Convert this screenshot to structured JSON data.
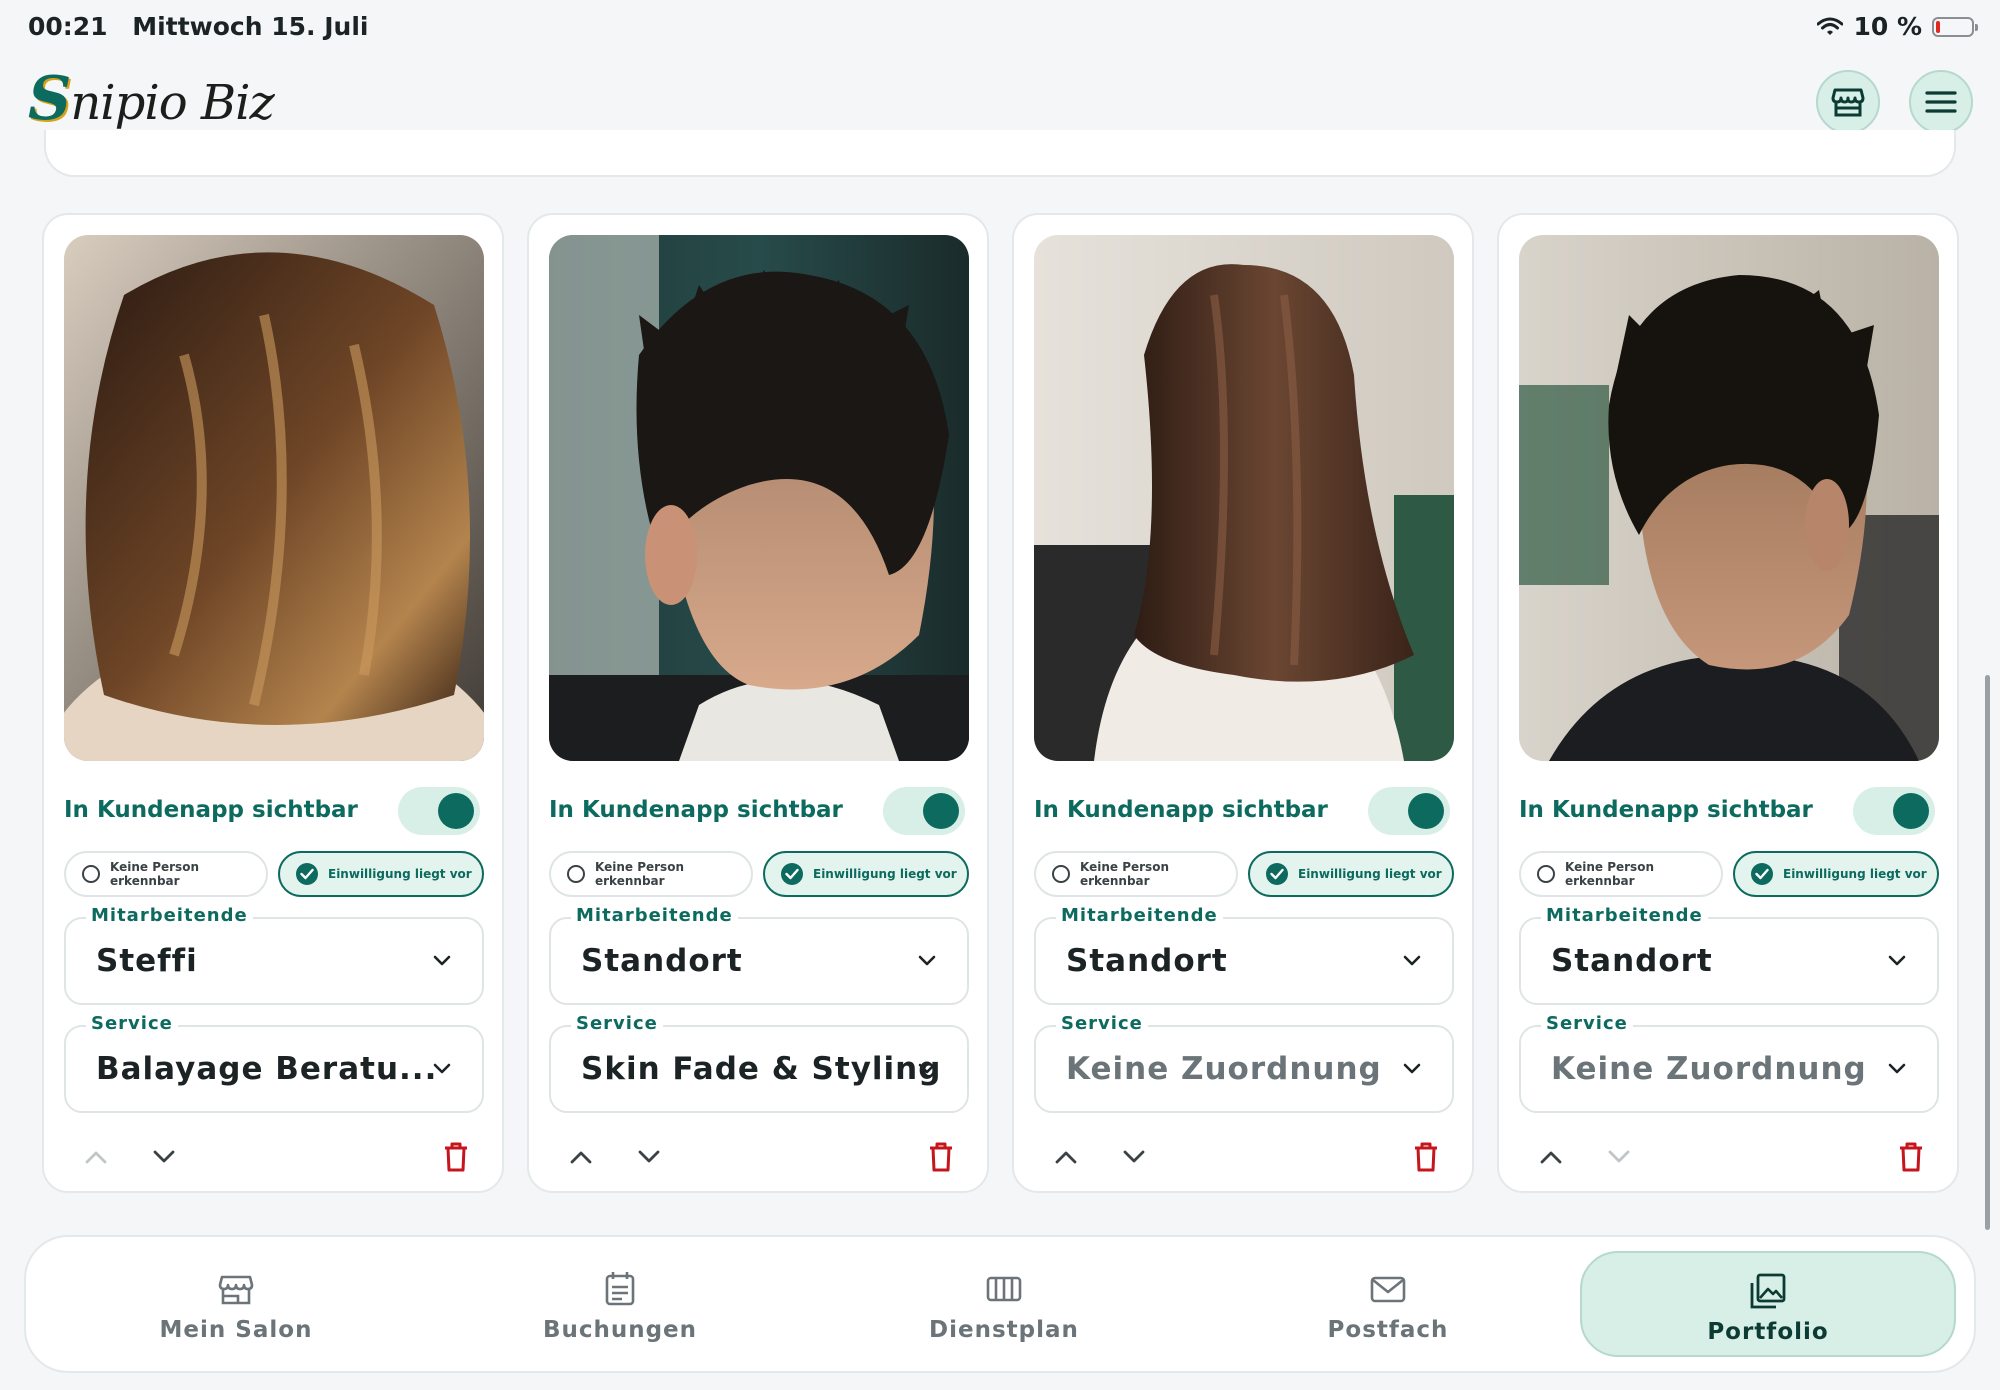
{
  "statusbar": {
    "time": "00:21",
    "date": "Mittwoch 15. Juli",
    "battery": "10 %"
  },
  "header": {
    "logo_initial": "S",
    "logo_rest": "nipio Biz"
  },
  "cards": [
    {
      "visible_label": "In Kundenapp sichtbar",
      "chip_off": "Keine Person erkennbar",
      "chip_on": "Einwilligung liegt vor",
      "staff_label": "Mitarbeitende",
      "staff_value": "Steffi",
      "service_label": "Service",
      "service_value": "Balayage Beratu..."
    },
    {
      "visible_label": "In Kundenapp sichtbar",
      "chip_off": "Keine Person erkennbar",
      "chip_on": "Einwilligung liegt vor",
      "staff_label": "Mitarbeitende",
      "staff_value": "Standort",
      "service_label": "Service",
      "service_value": "Skin Fade & Styling"
    },
    {
      "visible_label": "In Kundenapp sichtbar",
      "chip_off": "Keine Person erkennbar",
      "chip_on": "Einwilligung liegt vor",
      "staff_label": "Mitarbeitende",
      "staff_value": "Standort",
      "service_label": "Service",
      "service_value": "Keine Zuordnung"
    },
    {
      "visible_label": "In Kundenapp sichtbar",
      "chip_off": "Keine Person erkennbar",
      "chip_on": "Einwilligung liegt vor",
      "staff_label": "Mitarbeitende",
      "staff_value": "Standort",
      "service_label": "Service",
      "service_value": "Keine Zuordnung"
    }
  ],
  "nav": [
    {
      "label": "Mein Salon",
      "icon": "store-icon"
    },
    {
      "label": "Buchungen",
      "icon": "calendar-icon"
    },
    {
      "label": "Dienstplan",
      "icon": "schedule-icon"
    },
    {
      "label": "Postfach",
      "icon": "mail-icon"
    },
    {
      "label": "Portfolio",
      "icon": "gallery-icon"
    }
  ],
  "colors": {
    "accent": "#0c6b5e",
    "accent_light": "#d8efe7",
    "danger": "#c4161c"
  }
}
